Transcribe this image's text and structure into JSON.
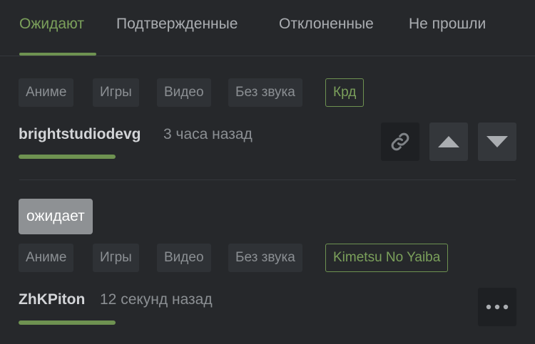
{
  "tabs": [
    {
      "label": "Ожидают",
      "active": true
    },
    {
      "label": "Подтвержденные",
      "active": false
    },
    {
      "label": "Отклоненные",
      "active": false
    },
    {
      "label": "Не прошли",
      "active": false
    }
  ],
  "colors": {
    "accent": "#7ba05b",
    "background": "#26282b",
    "chip": "#2f3236"
  },
  "posts": [
    {
      "tags": [
        "Аниме",
        "Игры",
        "Видео",
        "Без звука"
      ],
      "accent_tag": "Крд",
      "author": "brightstudiodevg",
      "time": "3 часа назад",
      "actions": [
        "link-icon",
        "arrow-up-icon",
        "arrow-down-icon"
      ]
    },
    {
      "status": "ожидает",
      "tags": [
        "Аниме",
        "Игры",
        "Видео",
        "Без звука"
      ],
      "accent_tag": "Kimetsu No Yaiba",
      "author": "ZhKPiton",
      "time": "12 секунд назад",
      "actions": [
        "more-icon"
      ]
    }
  ]
}
